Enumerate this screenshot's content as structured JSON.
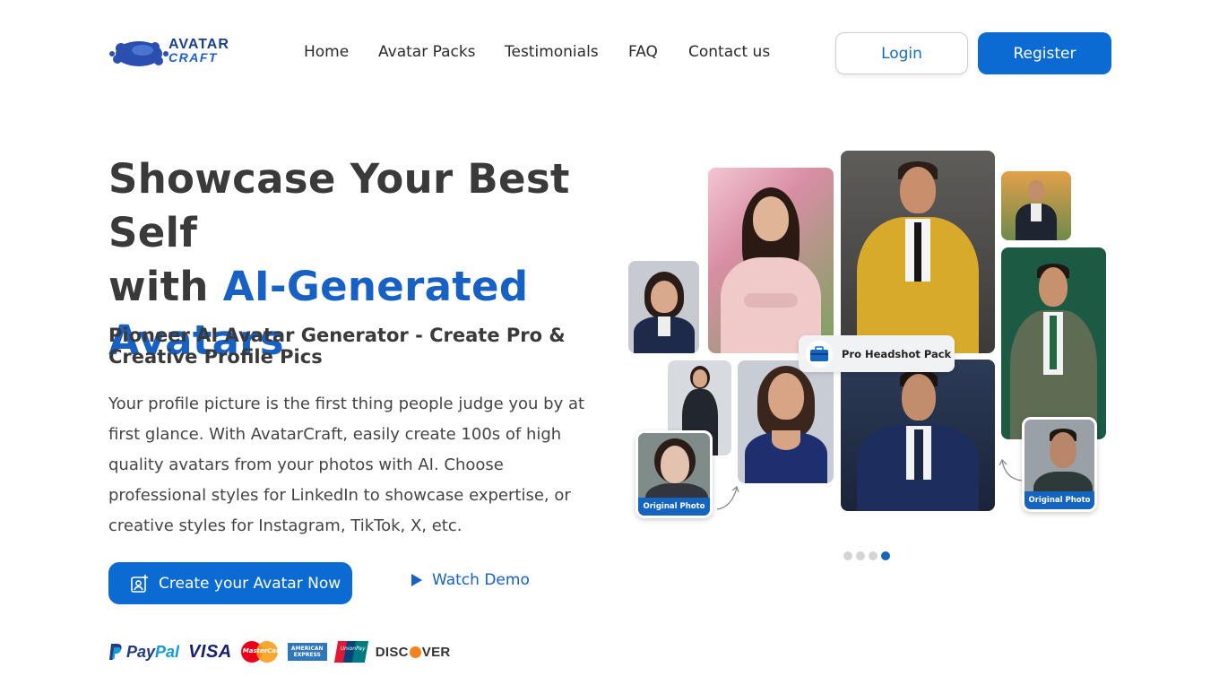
{
  "brand": {
    "logo_line1": "AVATAR",
    "logo_line2": "CRAFT",
    "accent_color": "#0c6bd2",
    "text_color": "#3a3a3a"
  },
  "nav": {
    "items": [
      "Home",
      "Avatar Packs",
      "Testimonials",
      "FAQ",
      "Contact us"
    ]
  },
  "header": {
    "login_label": "Login",
    "register_label": "Register"
  },
  "hero": {
    "title_line1": "Showcase Your Best Self",
    "title_with": "with ",
    "title_accent1": "AI-Generated",
    "title_accent2": "Avatars",
    "subtitle": "Pioneer AI Avatar Generator - Create Pro & Creative Profile Pics",
    "description": "Your profile picture is the first thing people judge you by at first glance. With AvatarCraft, easily create 100s of high quality avatars from your photos with AI. Choose professional styles for LinkedIn to showcase expertise, or creative styles for Instagram, TikTok, X, etc.",
    "cta_label": "Create your Avatar Now",
    "cta_icon": "avatar-add-icon",
    "watch_label": "Watch Demo",
    "watch_icon": "play-icon"
  },
  "payments": {
    "paypal": [
      "Pay",
      "Pal"
    ],
    "visa": "VISA",
    "mastercard": "MasterCard",
    "amex": "AMERICAN EXPRESS",
    "unionpay": "UnionPay",
    "discover": [
      "DISC",
      "VER"
    ]
  },
  "collage": {
    "badge_label": "Pro Headshot Pack",
    "badge_icon": "briefcase-icon",
    "original_label_left": "Original Photo",
    "original_label_right": "Original Photo",
    "carousel_active_index": 3,
    "carousel_count": 4
  }
}
